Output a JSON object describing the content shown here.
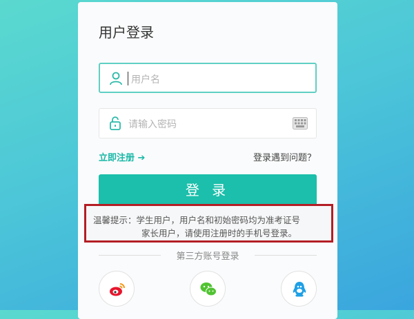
{
  "login": {
    "title": "用户登录",
    "username_placeholder": "用户名",
    "password_placeholder": "请输入密码",
    "register_link": "立即注册 ➔",
    "problem_link": "登录遇到问题？",
    "login_button": "登 录"
  },
  "tip": {
    "line1": "温馨提示：学生用户，用户名和初始密码均为准考证号",
    "line2": "家长用户，请使用注册时的手机号登录。"
  },
  "third_party": {
    "label": "第三方账号登录",
    "providers": [
      {
        "icon": "weibo-icon",
        "color": "#e6162d"
      },
      {
        "icon": "wechat-icon",
        "color": "#51c332"
      },
      {
        "icon": "qq-icon",
        "color": "#1ea0e6"
      }
    ]
  },
  "colors": {
    "accent": "#1bbfab",
    "highlight_border": "#b31e24"
  }
}
